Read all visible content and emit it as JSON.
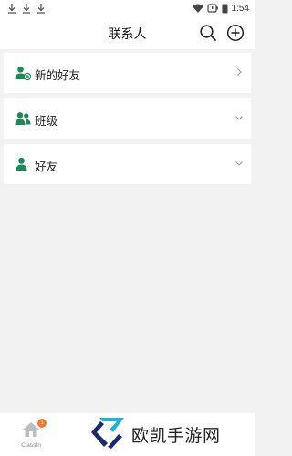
{
  "status_bar": {
    "time": "1:54",
    "icons": [
      "download-icon",
      "download-icon",
      "download-icon",
      "wifi-icon",
      "battery-icon",
      "sim-icon"
    ]
  },
  "header": {
    "title": "联系人",
    "icons": [
      "search-icon",
      "add-circle-icon"
    ]
  },
  "contacts": {
    "rows": [
      {
        "label": "新的好友",
        "icon": "new-friend-icon",
        "chevron": "chevron-right-icon"
      },
      {
        "label": "班级",
        "icon": "class-group-icon",
        "chevron": "chevron-down-icon"
      },
      {
        "label": "好友",
        "icon": "friend-icon",
        "chevron": "chevron-down-icon"
      }
    ]
  },
  "tab_bar": {
    "classin_label": "ClassIn",
    "badge": "1"
  },
  "watermark": {
    "text": "欧凯手游网"
  },
  "colors": {
    "accent_green": "#1c8a55",
    "badge_orange": "#f07a2a",
    "background": "#f2f2f2"
  }
}
